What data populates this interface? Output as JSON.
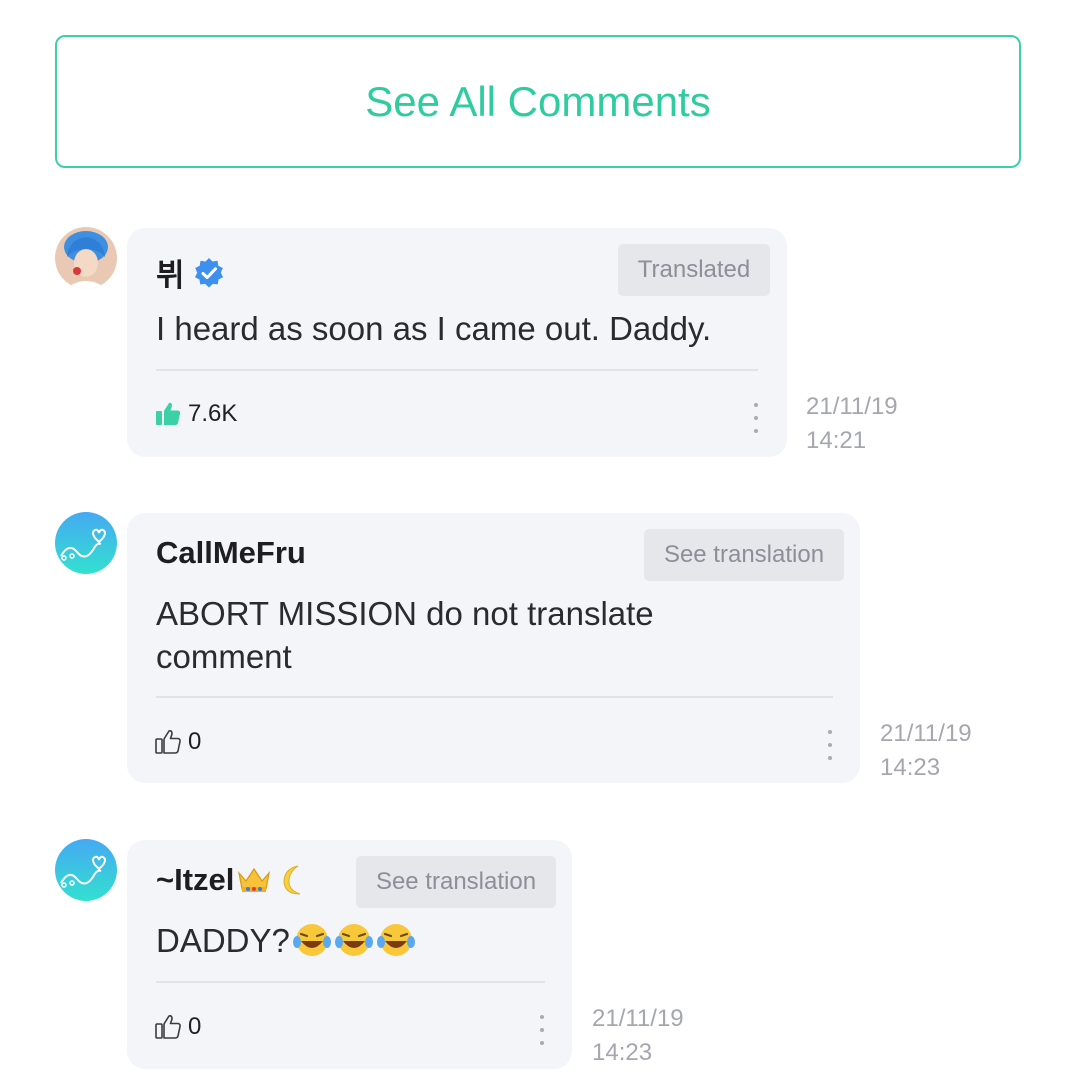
{
  "see_all_label": "See All Comments",
  "colors": {
    "accent": "#2ecc9f",
    "bubble_bg": "#f4f5f9",
    "verified": "#3d8ff0"
  },
  "comments": [
    {
      "author": "뷔",
      "verified": true,
      "translate_label": "Translated",
      "text": "I heard as soon as I came out. Daddy.",
      "likes": "7.6K",
      "liked": true,
      "date": "21/11/19",
      "time": "14:21"
    },
    {
      "author": "CallMeFru",
      "verified": false,
      "translate_label": "See translation",
      "text": "ABORT MISSION do not translate comment",
      "likes": "0",
      "liked": false,
      "date": "21/11/19",
      "time": "14:23"
    },
    {
      "author": "~Itzel",
      "author_emojis": [
        "crown-emoji",
        "crescent-moon-emoji"
      ],
      "verified": false,
      "translate_label": "See translation",
      "text": "DADDY?",
      "text_emojis": [
        "laughing-tears-emoji",
        "laughing-tears-emoji",
        "laughing-tears-emoji"
      ],
      "likes": "0",
      "liked": false,
      "date": "21/11/19",
      "time": "14:23"
    }
  ]
}
